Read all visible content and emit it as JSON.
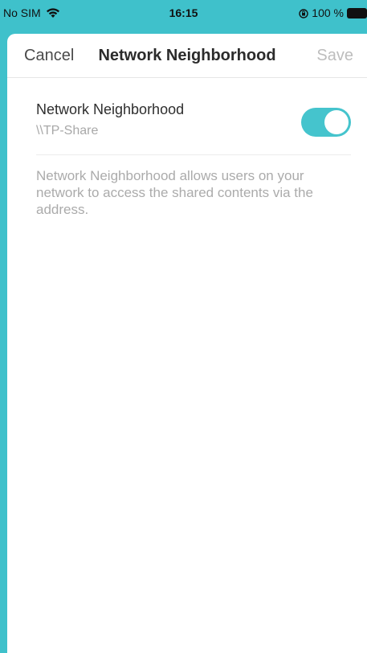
{
  "status_bar": {
    "carrier": "No SIM",
    "time": "16:15",
    "battery": "100 %"
  },
  "nav": {
    "cancel_label": "Cancel",
    "title": "Network Neighborhood",
    "save_label": "Save"
  },
  "setting": {
    "title": "Network Neighborhood",
    "address": "\\\\TP-Share",
    "enabled": true
  },
  "description": "Network Neighborhood allows users on your network to access the shared contents via the address.",
  "colors": {
    "accent": "#3fc1cb",
    "toggle_on": "#45c4cd",
    "save_disabled": "#bdbdbd"
  }
}
